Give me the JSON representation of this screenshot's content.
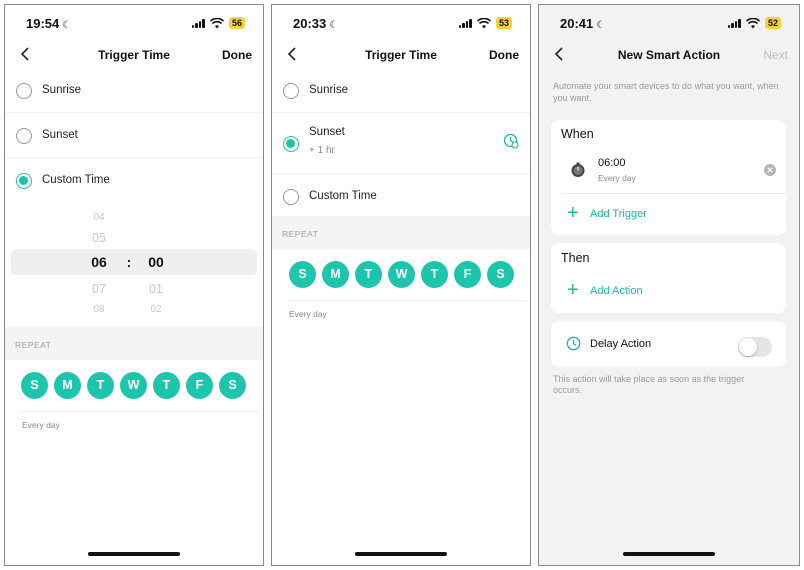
{
  "screens": [
    {
      "time": "19:54",
      "battery": "56",
      "title": "Trigger Time",
      "right_action": "Done",
      "options": [
        {
          "label": "Sunrise",
          "selected": false
        },
        {
          "label": "Sunset",
          "selected": false
        },
        {
          "label": "Custom Time",
          "selected": true
        }
      ],
      "picker": {
        "hours": [
          "04",
          "05",
          "06",
          "07",
          "08"
        ],
        "minutes": [
          "01",
          "02"
        ],
        "selected_hour": "06",
        "selected_minute": "00",
        "separator": ":"
      },
      "repeat_label": "REPEAT",
      "days": [
        "S",
        "M",
        "T",
        "W",
        "T",
        "F",
        "S"
      ],
      "repeat_summary": "Every day"
    },
    {
      "time": "20:33",
      "battery": "53",
      "title": "Trigger Time",
      "right_action": "Done",
      "options": [
        {
          "label": "Sunrise",
          "selected": false
        },
        {
          "label": "Sunset",
          "sublabel": "+ 1 hr",
          "selected": true
        },
        {
          "label": "Custom Time",
          "selected": false
        }
      ],
      "repeat_label": "REPEAT",
      "days": [
        "S",
        "M",
        "T",
        "W",
        "T",
        "F",
        "S"
      ],
      "repeat_summary": "Every day"
    },
    {
      "time": "20:41",
      "battery": "52",
      "title": "New Smart Action",
      "right_action": "Next",
      "intro": "Automate your smart devices to do what you want, when you want.",
      "when_title": "When",
      "trigger_time": "06:00",
      "trigger_repeat": "Every day",
      "add_trigger": "Add Trigger",
      "then_title": "Then",
      "add_action": "Add Action",
      "delay_label": "Delay Action",
      "delay_on": false,
      "footer": "This action will take place as soon as the trigger occurs."
    }
  ],
  "colors": {
    "accent": "#1ec5ad",
    "battery": "#f2d33c"
  }
}
